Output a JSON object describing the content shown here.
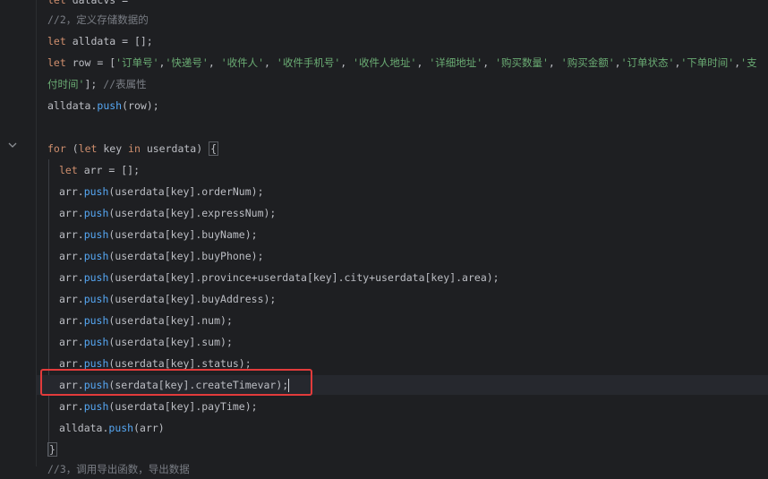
{
  "editor": {
    "lines": [
      {
        "id": "l0",
        "text": "let datacvs = '存储数据'"
      },
      {
        "id": "l1",
        "text": "//2，定义存储数据的"
      },
      {
        "id": "l2",
        "text": "let alldata = [];"
      },
      {
        "id": "l3a",
        "text": "let row = ['订单号','快递号', '收件人', '收件手机号', '收件人地址', '详细地址', '购买数量', '购买金额','订单状态','下单时间','支"
      },
      {
        "id": "l3b",
        "text": "付时间']; //表属性"
      },
      {
        "id": "l4",
        "text": "alldata.push(row);"
      },
      {
        "id": "l5",
        "text": ""
      },
      {
        "id": "l6",
        "text": "for (let key in userdata) {"
      },
      {
        "id": "l7",
        "text": "let arr = [];"
      },
      {
        "id": "l8",
        "text": "arr.push(userdata[key].orderNum);"
      },
      {
        "id": "l9",
        "text": "arr.push(userdata[key].expressNum);"
      },
      {
        "id": "l10",
        "text": "arr.push(userdata[key].buyName);"
      },
      {
        "id": "l11",
        "text": "arr.push(userdata[key].buyPhone);"
      },
      {
        "id": "l12",
        "text": "arr.push(userdata[key].province+userdata[key].city+userdata[key].area);"
      },
      {
        "id": "l13",
        "text": "arr.push(userdata[key].buyAddress);"
      },
      {
        "id": "l14",
        "text": "arr.push(userdata[key].num);"
      },
      {
        "id": "l15",
        "text": "arr.push(userdata[key].sum);"
      },
      {
        "id": "l16",
        "text": "arr.push(userdata[key].status);"
      },
      {
        "id": "l17",
        "text": "arr.push(serdata[key].createTimevar);"
      },
      {
        "id": "l18",
        "text": "arr.push(userdata[key].payTime);"
      },
      {
        "id": "l19",
        "text": "alldata.push(arr)"
      },
      {
        "id": "l20",
        "text": "}"
      }
    ],
    "colors": {
      "background": "#1e1f22",
      "keyword": "#cf8e6d",
      "string": "#6aab73",
      "comment": "#7a7e85",
      "function": "#56a8f5",
      "property": "#c77dbb",
      "annotation_box": "#e23b3b"
    },
    "fold_icon": "chevron-down-icon"
  }
}
